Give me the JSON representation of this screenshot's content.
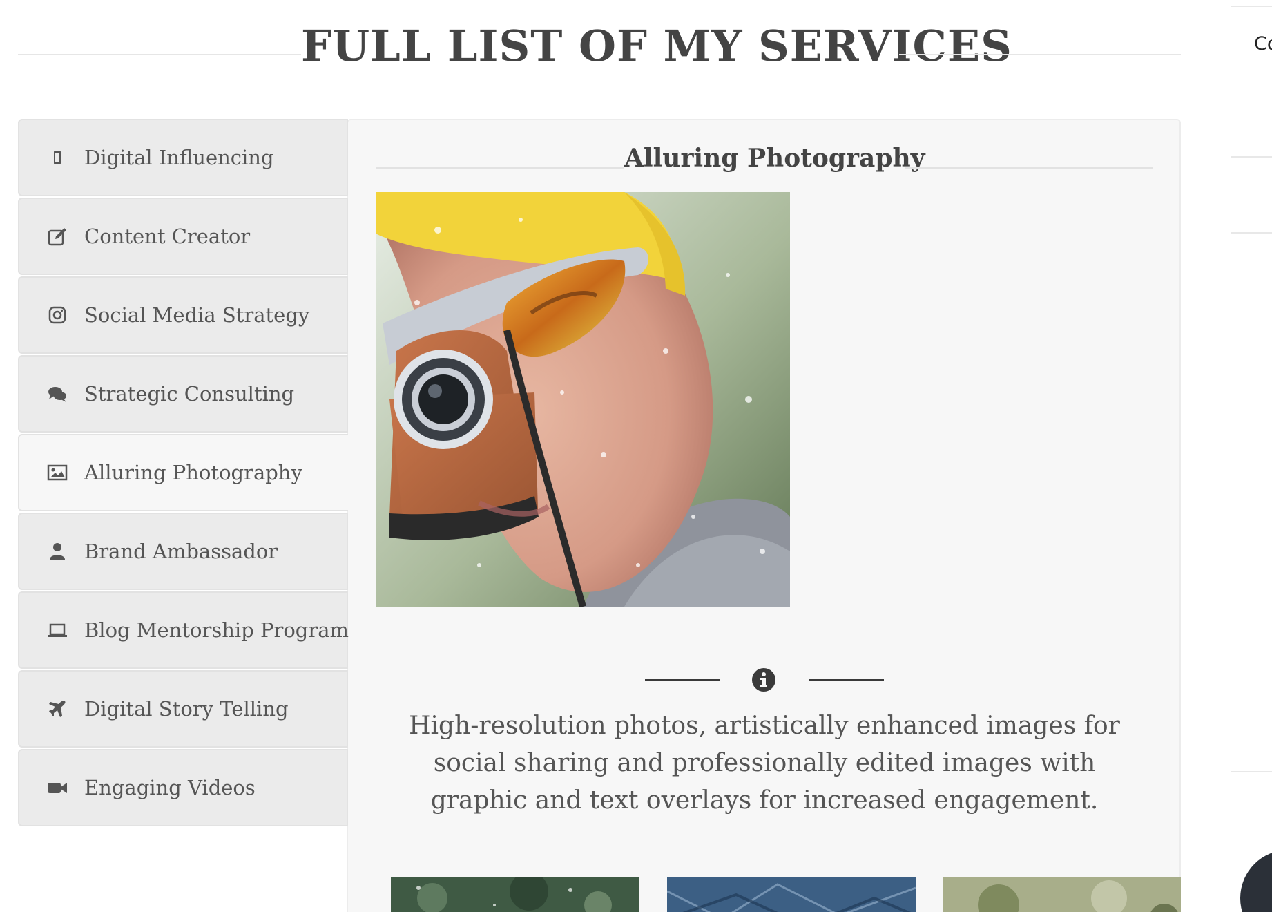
{
  "header": {
    "title": "FULL LIST OF MY SERVICES"
  },
  "right_edge": {
    "text": "Co"
  },
  "services": [
    {
      "label": "Digital Influencing",
      "icon": "mobile-icon"
    },
    {
      "label": "Content Creator",
      "icon": "edit-icon"
    },
    {
      "label": "Social Media Strategy",
      "icon": "instagram-icon"
    },
    {
      "label": "Strategic Consulting",
      "icon": "comments-icon"
    },
    {
      "label": "Alluring Photography",
      "icon": "image-icon"
    },
    {
      "label": "Brand Ambassador",
      "icon": "user-icon"
    },
    {
      "label": "Blog Mentorship Program",
      "icon": "laptop-icon"
    },
    {
      "label": "Digital Story Telling",
      "icon": "plane-icon"
    },
    {
      "label": "Engaging Videos",
      "icon": "video-camera-icon"
    }
  ],
  "active_service": "Alluring Photography",
  "content": {
    "title": "Alluring Photography",
    "description": "High-resolution photos, artistically enhanced images for social sharing and professionally edited images with graphic and text overlays for increased engagement.",
    "info_icon": "info-circle-icon"
  },
  "colors": {
    "tab_bg": "#ebebeb",
    "active_bg": "#f7f7f7",
    "text": "#555555",
    "title": "#444444"
  }
}
